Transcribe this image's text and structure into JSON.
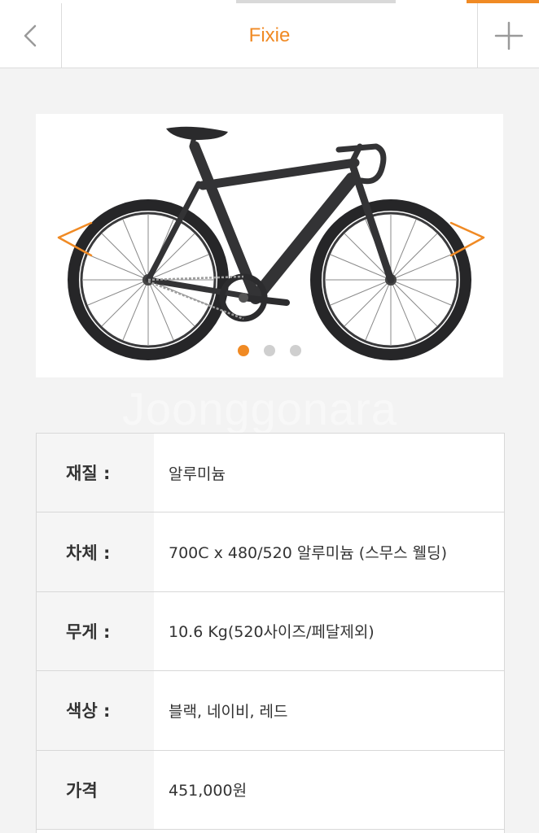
{
  "header": {
    "title": "Fixie",
    "back_icon": "chevron-left-icon",
    "add_icon": "plus-icon"
  },
  "carousel": {
    "slide_count": 3,
    "active_index": 0,
    "prev_icon": "chevron-left-icon",
    "next_icon": "chevron-right-icon"
  },
  "watermark": "Joonggonara",
  "specs": [
    {
      "label": "재질 :",
      "value": "알루미늄"
    },
    {
      "label": "차체 :",
      "value": "700C x 480/520 알루미늄 (스무스 웰딩)"
    },
    {
      "label": "무게 :",
      "value": "10.6 Kg(520사이즈/페달제외)"
    },
    {
      "label": "색상 :",
      "value": "블랙, 네이비, 레드"
    },
    {
      "label": "가격",
      "value": "451,000원"
    }
  ],
  "colors": {
    "accent": "#f08a24",
    "bike": "#2f2f31",
    "border": "#d8d8d8"
  }
}
